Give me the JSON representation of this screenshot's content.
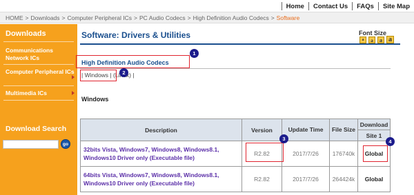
{
  "topnav": {
    "items": [
      "Home",
      "Contact Us",
      "FAQs",
      "Site Map"
    ]
  },
  "breadcrumb": {
    "items": [
      "HOME",
      "Downloads",
      "Computer Peripheral ICs",
      "PC Audio Codecs",
      "High Definition Audio Codecs"
    ],
    "separator": ">",
    "current": "Software"
  },
  "sidebar": {
    "heading": "Downloads",
    "items": [
      {
        "label": "Communications Network ICs"
      },
      {
        "label": "Computer Peripheral ICs"
      },
      {
        "label": "Multimedia ICs"
      }
    ],
    "search_heading": "Download Search",
    "search_value": "",
    "go_label": "go"
  },
  "main": {
    "title": "Software: Drivers & Utilities",
    "font_size_label": "Font Size",
    "font_buttons": [
      "a",
      "a",
      "a",
      "a"
    ],
    "codec_link": "High Definition Audio Codecs",
    "os_tabs": {
      "prefix": "| ",
      "windows": "Windows",
      "mid": " | ",
      "linux": "Linux",
      "linux_suffix": " (Linux) |"
    },
    "section_label": "Windows",
    "table": {
      "headers": {
        "description": "Description",
        "version": "Version",
        "update_time": "Update Time",
        "file_size": "File Size",
        "download": "Download",
        "site": "Site 1"
      },
      "rows": [
        {
          "description": "32bits Vista, Windows7, Windows8, Windows8.1, Windows10 Driver only (Executable file)",
          "version": "R2.82",
          "update_time": "2017/7/26",
          "file_size": "176740k",
          "site": "Global"
        },
        {
          "description": "64bits Vista, Windows7, Windows8, Windows8.1, Windows10 Driver only (Executable file)",
          "version": "R2.82",
          "update_time": "2017/7/26",
          "file_size": "264424k",
          "site": "Global"
        }
      ]
    }
  },
  "annotations": [
    "1",
    "2",
    "3",
    "4"
  ],
  "colors": {
    "sidebar": "#f6a11d",
    "accent_blue": "#1a4f8e",
    "link_purple": "#5b2fa8",
    "highlight_red": "#e0242f",
    "marker_navy": "#1c1c8c",
    "breadcrumb_current": "#e86b1a"
  }
}
